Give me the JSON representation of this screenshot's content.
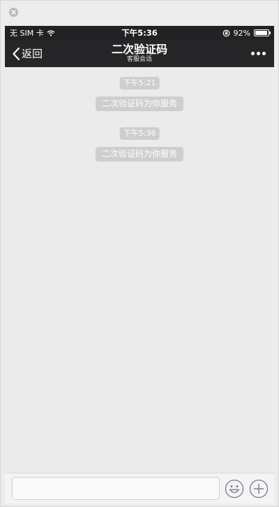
{
  "status_bar": {
    "carrier": "无 SIM 卡",
    "time": "下午5:36",
    "battery": "92%",
    "battery_level": 0.92
  },
  "nav": {
    "back_label": "返回",
    "title": "二次验证码",
    "subtitle": "客服会话"
  },
  "messages": [
    {
      "timestamp": "下午5:21",
      "text": "二次验证码为你服务"
    },
    {
      "timestamp": "下午5:36",
      "text": "二次验证码为你服务"
    }
  ],
  "input": {
    "value": "",
    "placeholder": ""
  },
  "icons": {
    "close": "close-icon",
    "wifi": "wifi-icon",
    "rotation_lock": "rotation-lock-icon",
    "battery": "battery-icon",
    "back": "chevron-left-icon",
    "more": "more-icon",
    "emoji": "emoji-icon",
    "plus": "plus-icon"
  }
}
